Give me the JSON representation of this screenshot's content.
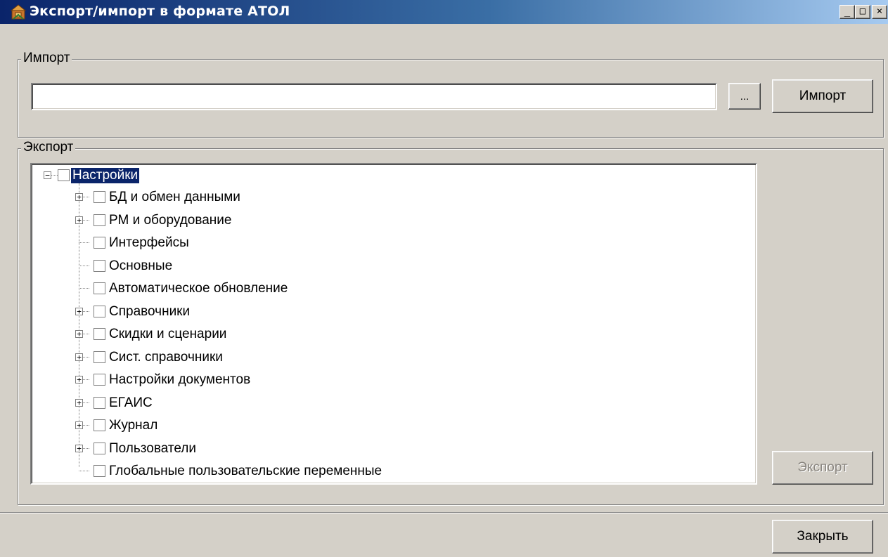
{
  "window": {
    "title": "Экспорт/импорт в формате АТОЛ",
    "controls": {
      "minimize": "_",
      "maximize": "□",
      "close": "×"
    }
  },
  "import_group": {
    "legend": "Импорт",
    "path_value": "",
    "browse_label": "...",
    "import_button": "Импорт"
  },
  "export_group": {
    "legend": "Экспорт",
    "export_button": "Экспорт",
    "export_button_enabled": false,
    "tree": {
      "root": {
        "label": "Настройки",
        "expanded": true,
        "checked": false,
        "selected": true
      },
      "children": [
        {
          "label": "БД и обмен данными",
          "expandable": true,
          "checked": false
        },
        {
          "label": "РМ и оборудование",
          "expandable": true,
          "checked": false
        },
        {
          "label": "Интерфейсы",
          "expandable": false,
          "checked": false
        },
        {
          "label": "Основные",
          "expandable": false,
          "checked": false
        },
        {
          "label": "Автоматическое обновление",
          "expandable": false,
          "checked": false
        },
        {
          "label": "Справочники",
          "expandable": true,
          "checked": false
        },
        {
          "label": "Скидки и сценарии",
          "expandable": true,
          "checked": false
        },
        {
          "label": "Сист. справочники",
          "expandable": true,
          "checked": false
        },
        {
          "label": "Настройки документов",
          "expandable": true,
          "checked": false
        },
        {
          "label": "ЕГАИС",
          "expandable": true,
          "checked": false
        },
        {
          "label": "Журнал",
          "expandable": true,
          "checked": false
        },
        {
          "label": "Пользователи",
          "expandable": true,
          "checked": false
        },
        {
          "label": "Глобальные пользовательские переменные",
          "expandable": false,
          "checked": false
        }
      ]
    }
  },
  "footer": {
    "close_button": "Закрыть"
  },
  "colors": {
    "titlebar_start": "#0a246a",
    "titlebar_end": "#a6caf0",
    "face": "#d4d0c8",
    "selection": "#0a246a"
  }
}
